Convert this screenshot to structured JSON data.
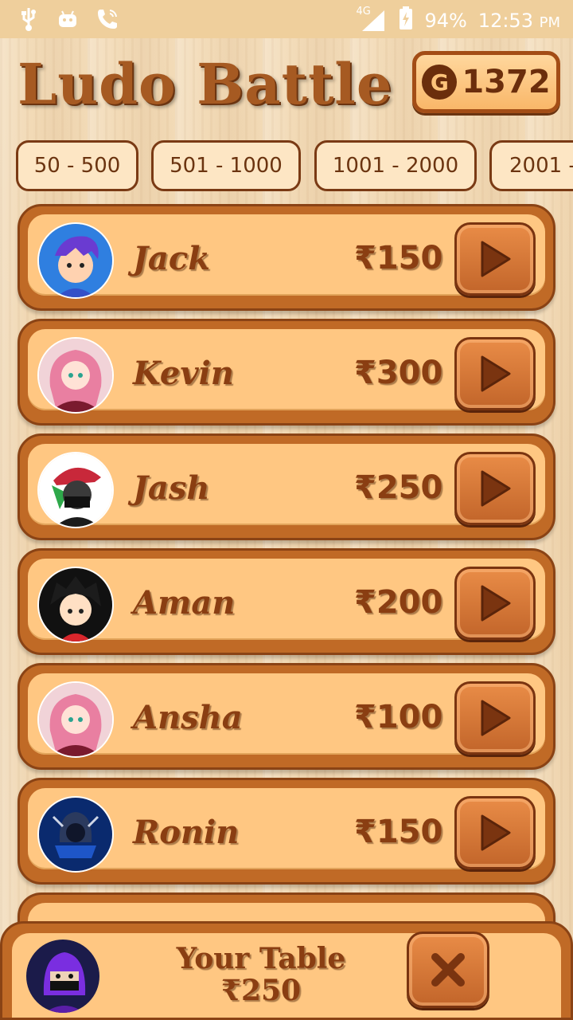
{
  "status_bar": {
    "icons_left": [
      "usb-icon",
      "android-icon",
      "phone-call-icon"
    ],
    "network": "4G",
    "battery": "94%",
    "time": "12:53",
    "ampm": "PM"
  },
  "header": {
    "title": "Ludo Battle",
    "coin_symbol": "G",
    "coins": "1372"
  },
  "tabs": [
    "50 - 500",
    "501 - 1000",
    "1001 - 2000",
    "2001 -"
  ],
  "players": [
    {
      "name": "Jack",
      "amount": "₹150",
      "avatar": "boy-purple-hair-avatar"
    },
    {
      "name": "Kevin",
      "amount": "₹300",
      "avatar": "anime-girl-pink-hair-avatar"
    },
    {
      "name": "Jash",
      "amount": "₹250",
      "avatar": "masked-boy-cap-avatar"
    },
    {
      "name": "Aman",
      "amount": "₹200",
      "avatar": "chibi-boy-black-hair-avatar"
    },
    {
      "name": "Ansha",
      "amount": "₹100",
      "avatar": "anime-girl-pink-hair-avatar"
    },
    {
      "name": "Ronin",
      "amount": "₹150",
      "avatar": "hooded-gamer-logo-avatar"
    }
  ],
  "your_table": {
    "label": "Your Table",
    "amount": "₹250",
    "avatar": "purple-ninja-avatar"
  },
  "colors": {
    "wood_dark": "#8a4315",
    "wood_mid": "#c06a26",
    "panel": "#ffc782",
    "text_brown": "#8a3e12"
  }
}
